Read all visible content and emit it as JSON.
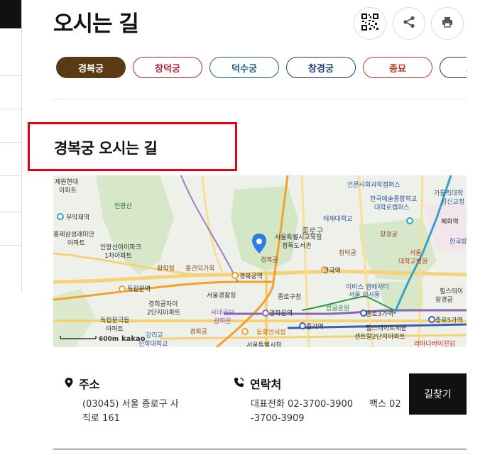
{
  "page": {
    "title": "오시는 길",
    "section_heading": "경복궁 오시는 길"
  },
  "toolbar": {
    "qr_icon": "qr-code-icon",
    "share_icon": "share-icon",
    "print_icon": "print-icon"
  },
  "tabs": [
    {
      "label": "경복궁",
      "active": true,
      "color": "#5a3a12"
    },
    {
      "label": "창덕궁",
      "active": false,
      "color": "#b0293c"
    },
    {
      "label": "덕수궁",
      "active": false,
      "color": "#1f5f74"
    },
    {
      "label": "창경궁",
      "active": false,
      "color": "#1d3f7a"
    },
    {
      "label": "종묘",
      "active": false,
      "color": "#c23a2b"
    },
    {
      "label": "조선",
      "active": false,
      "color": "#2b2b6b"
    }
  ],
  "map": {
    "marker_label": "경복궁",
    "scale_label": "600m",
    "brand": "kakao",
    "labels": {
      "a1": "제원현대",
      "a2": "아파트",
      "b1": "인왕산",
      "c1": "무악재역",
      "d1": "홍제삼성래미안",
      "d2": "아파트",
      "e1": "인왕산아이파크",
      "e2": "1차아파트",
      "f1": "황학정",
      "g1": "홍건익가옥",
      "h1": "독립문역",
      "i1": "경희궁자이",
      "i2": "2단지아파트",
      "j1": "독립문극동",
      "j2": "아파트",
      "k1": "경희궁",
      "l1": "강리교",
      "l2": "신학대학교",
      "m1": "경복궁역",
      "n1": "서울경찰청",
      "o1": "씨네큐브",
      "o2": "광화문",
      "p1": "광화문역",
      "q1": "동화면세점",
      "r1": "서울특별시청",
      "s1": "종로구청",
      "t1": "종각역",
      "u1": "탑골공원",
      "v1": "종로3가역",
      "w1": "종로5가역",
      "x1": "힐스테이트세운",
      "x2": "센트럴2단지아파트",
      "y1": "이비스 앰배서더",
      "y2": "서울 인사동",
      "z1": "안국역",
      "aa1": "창덕궁",
      "ab1": "서울특별시교육청",
      "ab2": "정독도서관",
      "ac1": "종로구",
      "ad1": "태재대학교",
      "ae1": "한국예술종합학교",
      "ae2": "대학로캠퍼스",
      "af1": "인문사회과학캠퍼스",
      "ag1": "가톨릭대학",
      "ag2": "성신교정",
      "ah1": "혜화역",
      "ai1": "창경궁",
      "aj1": "서울",
      "aj2": "대학교병원",
      "ak1": "한국방",
      "al1": "힐스테이",
      "al2": "창경궁",
      "am1": "라마다바이윈덤",
      "an1": "창덕궁"
    }
  },
  "address": {
    "label": "주소",
    "icon": "location-pin-icon",
    "line1": "(03045) 서울 종로구 사",
    "line2": "직로 161"
  },
  "contact": {
    "label": "연락처",
    "icon": "phone-icon",
    "line1": "대표전화 02-3700-3900",
    "line2": "-3700-3909",
    "fax": "팩스 02"
  },
  "route_button": {
    "label": "길찾기"
  }
}
